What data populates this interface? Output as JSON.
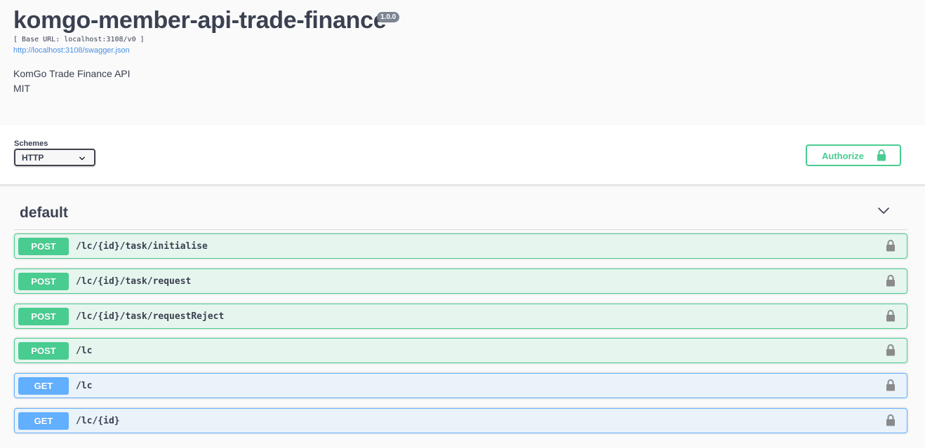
{
  "info": {
    "title": "komgo-member-api-trade-finance",
    "version": "1.0.0",
    "base_url": "[ Base URL: localhost:3108/v0 ]",
    "spec_link": "http://localhost:3108/swagger.json",
    "description": "KomGo Trade Finance API",
    "license": "MIT"
  },
  "schemes": {
    "label": "Schemes",
    "selected": "HTTP"
  },
  "authorize": {
    "label": "Authorize",
    "icon": "lock-icon"
  },
  "tag": {
    "name": "default",
    "icon": "chevron-down-icon"
  },
  "operations": [
    {
      "method": "POST",
      "path": "/lc/{id}/task/initialise"
    },
    {
      "method": "POST",
      "path": "/lc/{id}/task/request"
    },
    {
      "method": "POST",
      "path": "/lc/{id}/task/requestReject"
    },
    {
      "method": "POST",
      "path": "/lc"
    },
    {
      "method": "GET",
      "path": "/lc"
    },
    {
      "method": "GET",
      "path": "/lc/{id}"
    }
  ],
  "colors": {
    "post": "#49cc90",
    "get": "#61affe",
    "text": "#3b4151",
    "version_badge": "#7d8492"
  }
}
